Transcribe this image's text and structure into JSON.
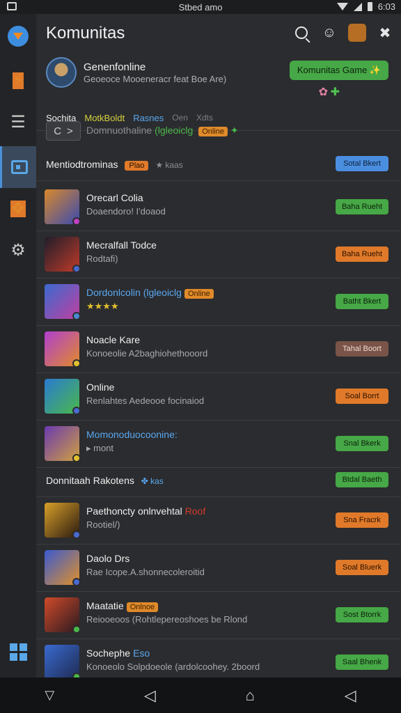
{
  "status": {
    "center_text": "Stbed amo",
    "time": "6:03"
  },
  "header": {
    "title": "Komunitas"
  },
  "profile": {
    "name": "Genenfonline",
    "subtitle": "Geoeoce Mooeneracr feat Boe Are)",
    "game_button": "Komunitas Game ✨",
    "tabs": [
      "Sochita",
      "MotkBoldt",
      "Rasnes",
      "Oen",
      "Xdts"
    ]
  },
  "search": {
    "back": "C",
    "forward": ">",
    "text": "Domnuothaline",
    "green_text": "(lgleoiclg",
    "badge": "Online"
  },
  "section1": {
    "title": "Mentiodtrominas",
    "tag": "Plao",
    "meta": "kaas",
    "button": "Sotal Bkert"
  },
  "rows1": [
    {
      "title": "Orecarl Colia",
      "subtitle": "Doaendoro! I'doaod",
      "button": "Baha Rueht",
      "btn_style": "green",
      "thumb_colors": [
        "#d8882a",
        "#3a4ab0"
      ],
      "dot_color": "#c040c0"
    },
    {
      "title": "Mecralfall Todce",
      "subtitle": "Rodtafi)",
      "button": "Baha Rueht",
      "btn_style": "orange",
      "thumb_colors": [
        "#1e1e2a",
        "#c03a2a"
      ],
      "dot_color": "#4a6ad0"
    },
    {
      "title": "Dordonlcolin (lgleoiclg",
      "subtitle": "★★★★",
      "button": "Batht Bkert",
      "btn_style": "green",
      "thumb_colors": [
        "#3a6ad0",
        "#c040a0"
      ],
      "dot_color": "#4a8ad0",
      "badge": "Online",
      "blue_title": true
    },
    {
      "title": "Noacle Kare",
      "subtitle": "Konoeolie A2baghiohethooord",
      "button": "Tahal Boort",
      "btn_style": "brown",
      "thumb_colors": [
        "#b040d0",
        "#e08a2a"
      ],
      "dot_color": "#e0c030"
    },
    {
      "title": "Online",
      "subtitle": "Renlahtes Aedeooe focinaiod",
      "button": "Soal Borrt",
      "btn_style": "orange",
      "thumb_colors": [
        "#2a7ad0",
        "#4ab84a"
      ],
      "dot_color": "#4a6ad0"
    },
    {
      "title": "Momonoduocoonine:",
      "subtitle": "▸ mont",
      "button": "Snal Bkerk",
      "btn_style": "green",
      "thumb_colors": [
        "#6a3ab0",
        "#d0a040"
      ],
      "dot_color": "#e0c030",
      "blue_title": true
    }
  ],
  "section2": {
    "title": "Donnitaah Rakotens",
    "meta": "kas",
    "button": "Btdal Baeth"
  },
  "rows2": [
    {
      "title": "Paethoncty onlnvehtal",
      "red_suffix": "Roof",
      "subtitle": "Rootiel/)",
      "button": "Sna Fracrk",
      "btn_style": "orange",
      "thumb_colors": [
        "#d8a02a",
        "#2a1a10"
      ],
      "dot_color": "#4a6ad0"
    },
    {
      "title": "Daolo Drs",
      "subtitle": "Rae Icope.A.shonnecoleroitid",
      "button": "Soal Bluerk",
      "btn_style": "orange",
      "thumb_colors": [
        "#3a5ad0",
        "#e0902a"
      ],
      "dot_color": "#4a6ad0"
    },
    {
      "title": "Maatatie",
      "subtitle": "Reiooeoos (Rohtlepereoshoes be Rlond",
      "button": "Sost Btorrk",
      "btn_style": "green",
      "thumb_colors": [
        "#d04a2a",
        "#2a1a20"
      ],
      "dot_color": "#4ab84a",
      "badge": "Onlnoe"
    },
    {
      "title": "Sochephe",
      "blue_suffix": "Eso",
      "subtitle": "Konoeolo Solpdoeole (ardolcoohey. 2boord",
      "button": "Saal Bhenk",
      "btn_style": "green",
      "thumb_colors": [
        "#3a6ad0",
        "#1e2a50"
      ],
      "dot_color": "#4ab84a"
    }
  ]
}
